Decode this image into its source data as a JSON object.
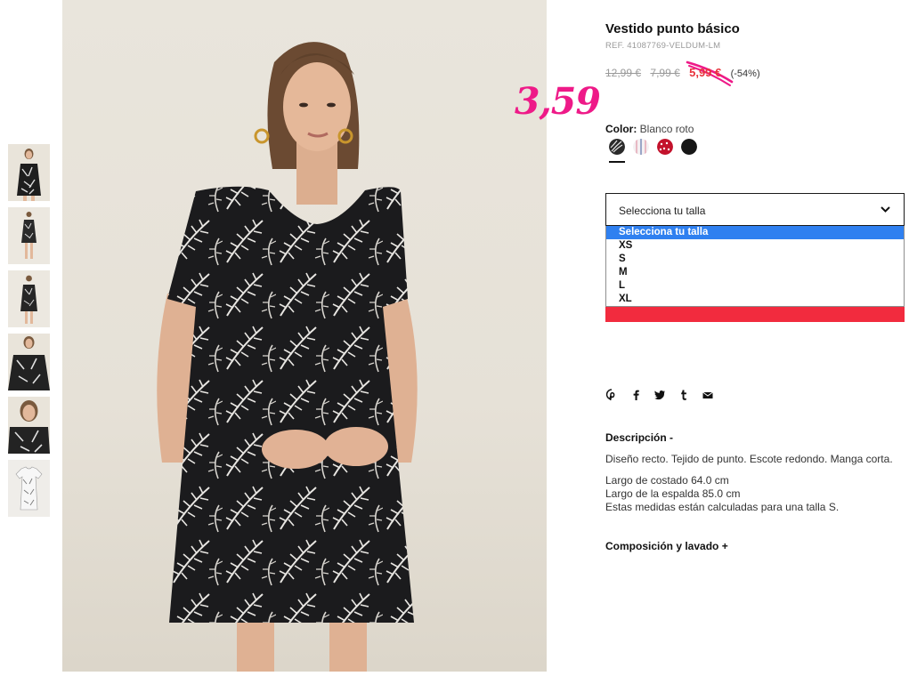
{
  "product": {
    "title": "Vestido punto básico",
    "ref": "REF. 41087769-VELDUM-LM",
    "prices": {
      "original": "12,99 €",
      "previous": "7,99 €",
      "current": "5,99 €",
      "discount": "(-54%)"
    },
    "handwritten_price": "3,59",
    "color": {
      "label": "Color:",
      "value": "Blanco roto",
      "swatches": [
        {
          "name": "black-white-leaf",
          "colors": [
            "#2a2a2a",
            "#e6e6e6"
          ]
        },
        {
          "name": "pink-white-stripe",
          "colors": [
            "#e8b9c4",
            "#ffffff"
          ]
        },
        {
          "name": "red-white-dots",
          "colors": [
            "#c3122c",
            "#ffffff"
          ]
        },
        {
          "name": "black",
          "colors": [
            "#161616"
          ]
        }
      ]
    },
    "size_select": {
      "placeholder": "Selecciona tu talla",
      "options": [
        "Selecciona tu talla",
        "XS",
        "S",
        "M",
        "L",
        "XL"
      ],
      "selected_index": 0
    },
    "description": {
      "heading": "Descripción -",
      "lines": [
        "Diseño recto. Tejido de punto. Escote redondo. Manga corta.",
        "Largo de costado 64.0 cm",
        "Largo de la espalda 85.0 cm",
        "Estas medidas están calculadas para una talla S."
      ]
    },
    "composition_heading": "Composición y lavado +"
  },
  "share_icons": [
    "pinterest-icon",
    "facebook-icon",
    "twitter-icon",
    "tumblr-icon",
    "email-icon"
  ],
  "colors": {
    "accent_red": "#f22b3e",
    "price_red": "#e8323c",
    "handwriting_pink": "#ee1a88",
    "dropdown_highlight": "#2f80f0"
  }
}
